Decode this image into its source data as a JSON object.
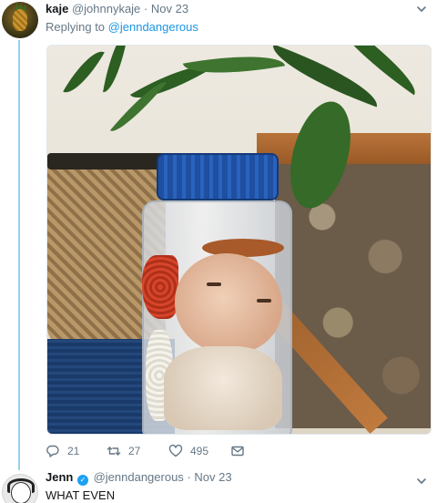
{
  "tweets": [
    {
      "name": "kaje",
      "handle": "@johnnykaje",
      "separator": "·",
      "date": "Nov 23",
      "reply_prefix": "Replying to",
      "reply_mention": "@jenndangerous",
      "actions": {
        "reply_count": "21",
        "retweet_count": "27",
        "like_count": "495"
      }
    },
    {
      "name": "Jenn",
      "verified": true,
      "handle": "@jenndangerous",
      "separator": "·",
      "date": "Nov 23",
      "text": "WHAT EVEN"
    }
  ],
  "icons": {
    "avatar_1": "pineapple-avatar",
    "avatar_2": "cartoon-face-avatar",
    "verified": "verified-badge-icon",
    "caret": "chevron-down-icon",
    "reply": "reply-icon",
    "retweet": "retweet-icon",
    "like": "heart-icon",
    "dm": "envelope-icon"
  },
  "colors": {
    "accent": "#1b95e0",
    "muted": "#657786",
    "thread_line": "#9ad0ef",
    "text": "#14171a"
  }
}
